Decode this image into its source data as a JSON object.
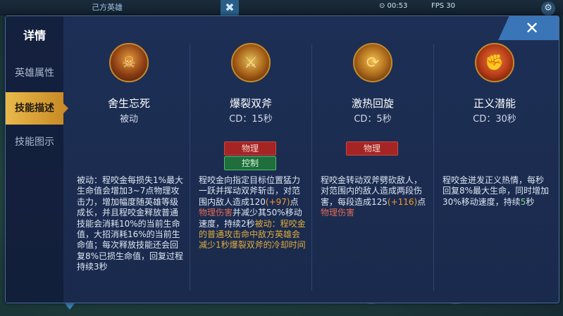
{
  "hud": {
    "title": "己方英雄",
    "timer": "⊙ 00:53",
    "fps": "FPS 30",
    "close_glyph": "✖",
    "settings_glyph": "⚙"
  },
  "panel": {
    "title": "详情",
    "close_glyph": "✕",
    "tabs": [
      {
        "label": "英雄属性",
        "active": false
      },
      {
        "label": "技能描述",
        "active": true
      },
      {
        "label": "技能图示",
        "active": false
      }
    ]
  },
  "skills": [
    {
      "icon": "passive-skill-icon",
      "name": "舍生忘死",
      "cd": "被动",
      "tags": [],
      "desc": [
        {
          "t": "被动：程咬金每损失1%最大生命值会增加3~7点物理攻击力，增加幅度随英雄等级成长，并且程咬金释放普通技能会消耗10%的当前生命值，大招消耗16%的当前生命值；每次释放技能还会回复8%已损生命值，回复过程持续3秒",
          "c": ""
        }
      ]
    },
    {
      "icon": "axe-burst-icon",
      "name": "爆裂双斧",
      "cd": "CD：15秒",
      "tags": [
        {
          "label": "物理",
          "kind": "phys"
        },
        {
          "label": "控制",
          "kind": "ctrl"
        }
      ],
      "desc": [
        {
          "t": "程咬金向指定目标位置猛力一跃并挥动双斧斩击，对范围内敌人造成120",
          "c": ""
        },
        {
          "t": "(+97)",
          "c": "hl"
        },
        {
          "t": "点",
          "c": ""
        },
        {
          "t": "物理伤害",
          "c": "red"
        },
        {
          "t": "并减少其50%移动速度，持续2秒",
          "c": ""
        },
        {
          "t": "被动：程咬金的普通攻击命中敌方英雄会减少1秒爆裂双斧的冷却时间",
          "c": "gold"
        }
      ]
    },
    {
      "icon": "spin-axe-icon",
      "name": "激热回旋",
      "cd": "CD：5秒",
      "tags": [
        {
          "label": "物理",
          "kind": "phys"
        }
      ],
      "desc": [
        {
          "t": "程咬金转动双斧劈砍敌人，对范围内的敌人造成两段伤害，每段造成125",
          "c": ""
        },
        {
          "t": "(+116)",
          "c": "hl"
        },
        {
          "t": "点",
          "c": ""
        },
        {
          "t": "物理伤害",
          "c": "red"
        }
      ]
    },
    {
      "icon": "justice-rage-icon",
      "name": "正义潜能",
      "cd": "CD：30秒",
      "tags": [],
      "desc": [
        {
          "t": "程咬金迸发正义热情，每秒回复8%最大生命，同时增加30%移动速度，持续",
          "c": ""
        },
        {
          "t": "5",
          "c": "grn"
        },
        {
          "t": "秒",
          "c": ""
        }
      ]
    }
  ],
  "colors": {
    "panel_bg": "#1d2f55",
    "active_tab": "#e9b94a",
    "close_tab": "#3a75b8",
    "tag_physical": "#a52524",
    "tag_control": "#1f6e3b",
    "highlight_orange": "#f19a33",
    "damage_red": "#e06a55",
    "passive_gold": "#e0ad3c"
  }
}
